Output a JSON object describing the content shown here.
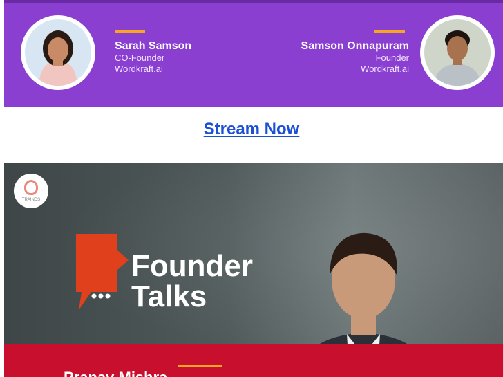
{
  "banner": {
    "left_person": {
      "name": "Sarah Samson",
      "role": "CO-Founder",
      "org": "Wordkraft.ai"
    },
    "right_person": {
      "name": "Samson Onnapuram",
      "role": "Founder",
      "org": "Wordkraft.ai"
    },
    "colors": {
      "background": "#8a3fd1",
      "accent": "#f6a623"
    }
  },
  "stream_link": {
    "label": "Stream Now",
    "color": "#1a4fd6"
  },
  "card": {
    "title_line1": "Founder",
    "title_line2": "Talks",
    "badge_text": "TRAINDS",
    "bottom_text": "Pranav Mishra",
    "colors": {
      "band": "#c8102e",
      "title": "#ffffff",
      "icon": "#e0401b"
    }
  }
}
